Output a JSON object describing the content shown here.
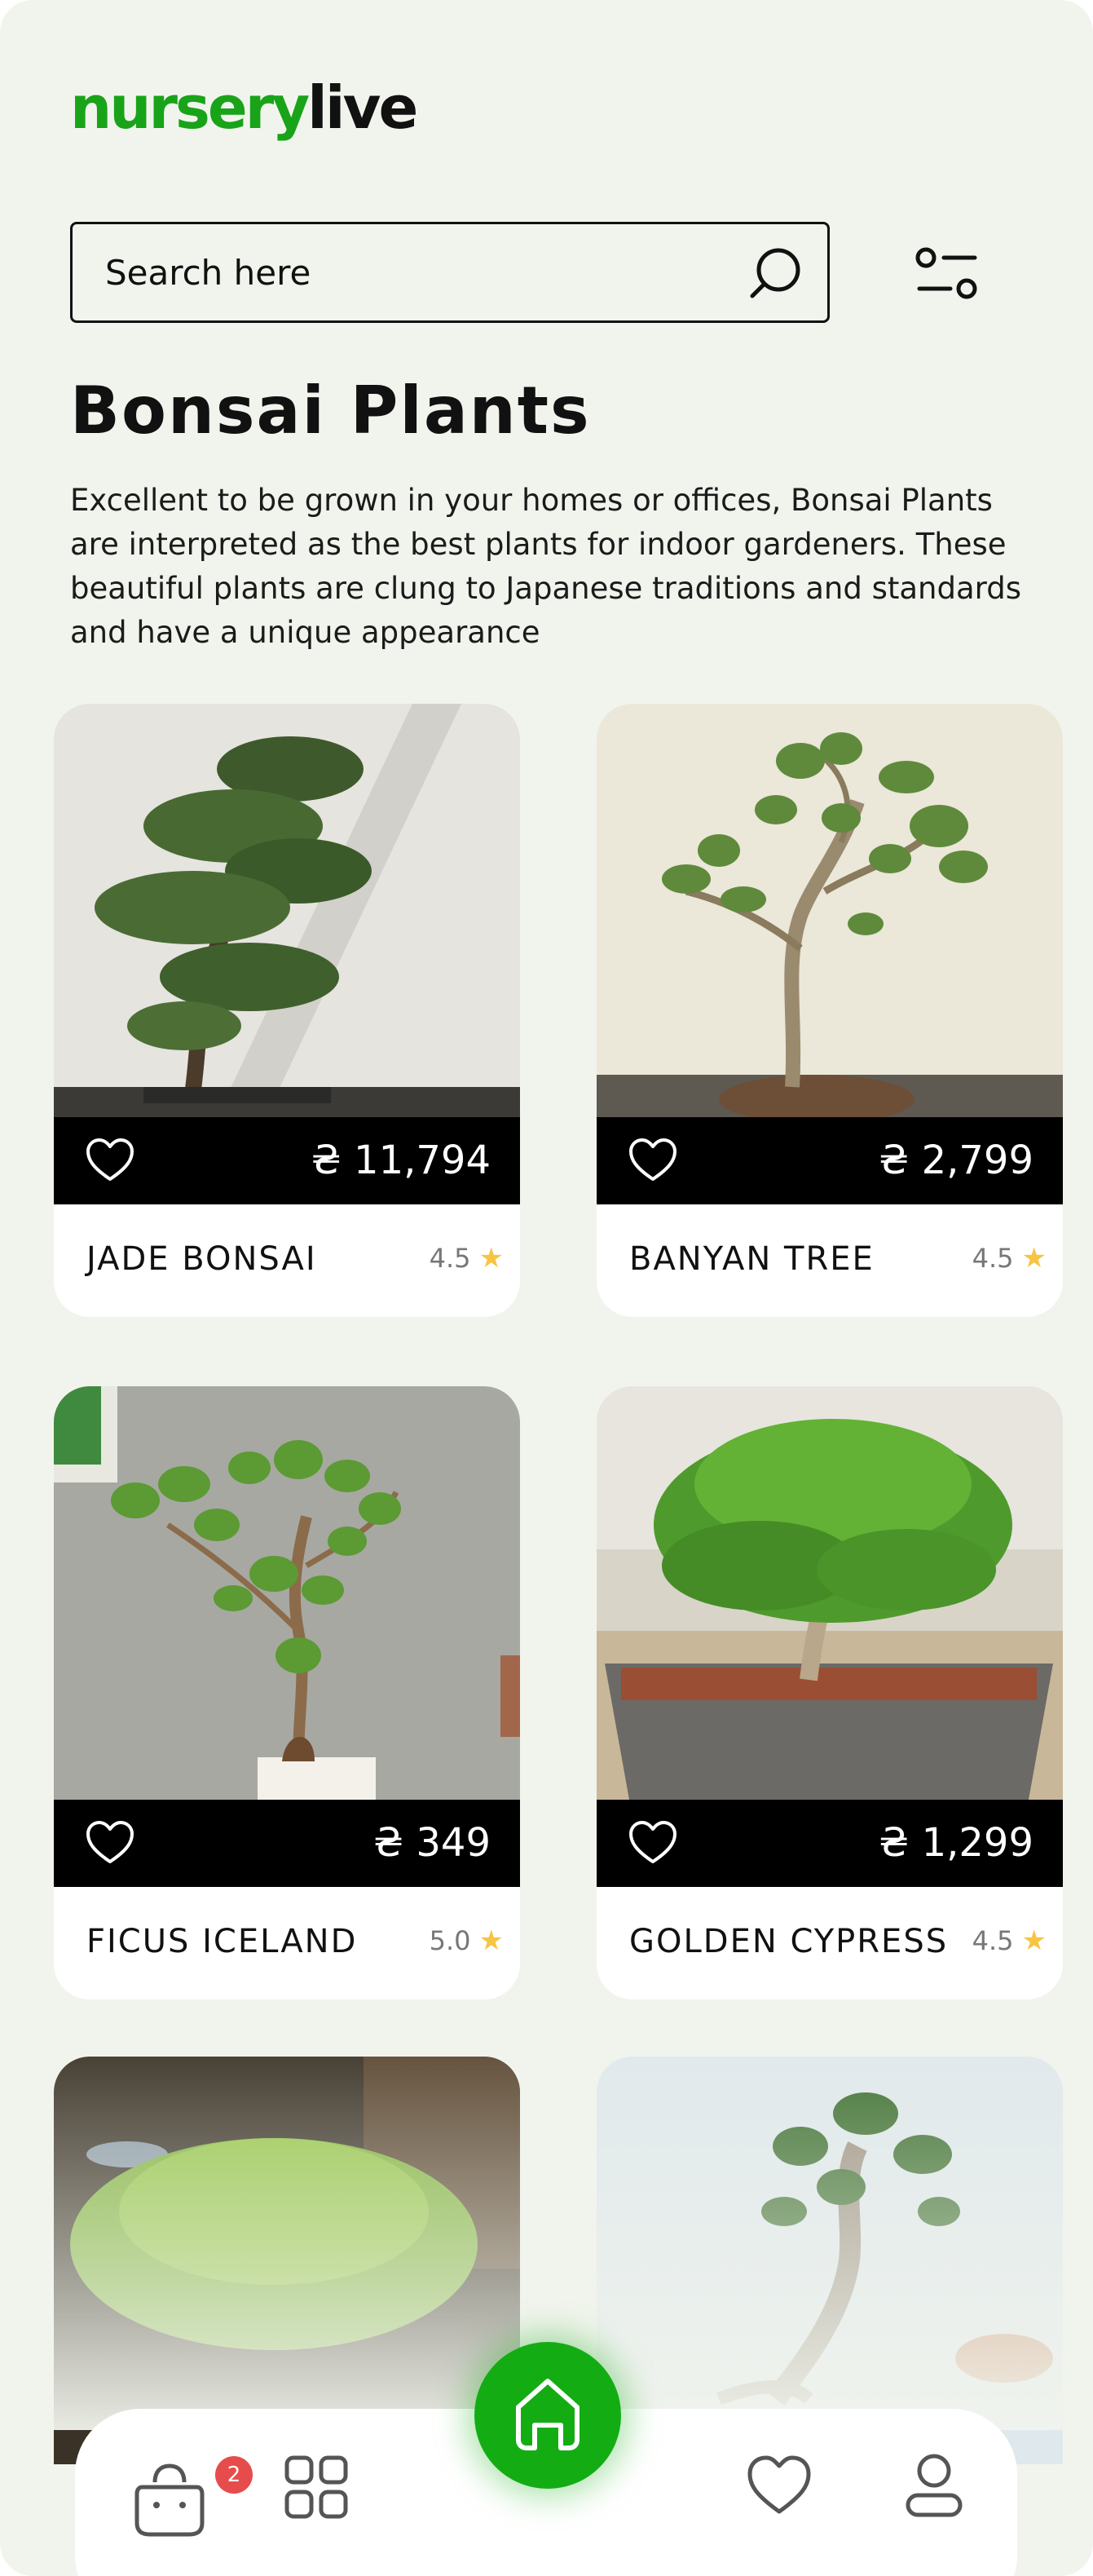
{
  "brand": {
    "part1": "nursery",
    "part2": "live"
  },
  "search": {
    "placeholder": "Search here"
  },
  "page": {
    "title": "Bonsai Plants",
    "description": "Excellent to be grown in your homes or offices, Bonsai Plants are interpreted as the best plants for indoor gardeners. These beautiful plants are clung to Japanese traditions and standards and have a unique appearance"
  },
  "currency_symbol": "₴",
  "products": [
    {
      "name": "JADE BONSAI",
      "price": "₴ 11,794",
      "rating": "4.5"
    },
    {
      "name": "BANYAN TREE",
      "price": "₴ 2,799",
      "rating": "4.5"
    },
    {
      "name": "FICUS ICELAND",
      "price": "₴ 349",
      "rating": "5.0"
    },
    {
      "name": "GOLDEN CYPRESS",
      "price": "₴ 1,299",
      "rating": "4.5"
    }
  ],
  "bottom_nav": {
    "cart_count": "2",
    "icons": [
      "shopping-bag-icon",
      "grid-icon",
      "home-icon",
      "heart-icon",
      "user-icon"
    ]
  },
  "colors": {
    "brand_green": "#19a319",
    "home_button": "#13ad13",
    "badge": "#e74c4c",
    "star": "#f6c544"
  }
}
